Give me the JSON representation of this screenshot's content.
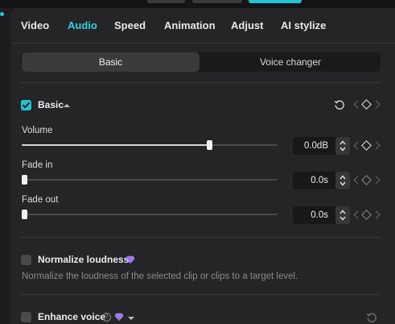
{
  "tabs": [
    {
      "label": "Video",
      "active": false
    },
    {
      "label": "Audio",
      "active": true
    },
    {
      "label": "Speed",
      "active": false
    },
    {
      "label": "Animation",
      "active": false
    },
    {
      "label": "Adjust",
      "active": false
    },
    {
      "label": "AI stylize",
      "active": false
    }
  ],
  "segmented": {
    "basic_label": "Basic",
    "voice_changer_label": "Voice changer",
    "selected": "Basic"
  },
  "basic_section": {
    "title": "Basic",
    "checked": true,
    "expanded": true,
    "controls": [
      {
        "label": "Volume",
        "value": "0.0dB",
        "slider_fraction": 0.74
      },
      {
        "label": "Fade in",
        "value": "0.0s",
        "slider_fraction": 0.0
      },
      {
        "label": "Fade out",
        "value": "0.0s",
        "slider_fraction": 0.0
      }
    ]
  },
  "normalize_section": {
    "title": "Normalize loudness",
    "checked": false,
    "premium": true,
    "description": "Normalize the loudness of the selected clip or clips to a target level."
  },
  "enhance_section": {
    "title": "Enhance voice",
    "checked": false,
    "premium": true
  },
  "colors": {
    "accent": "#2ad3e0",
    "checkbox_checked": "#22c4d4",
    "premium_gem": "#b48cff"
  },
  "icons": {
    "reset": "reset-icon",
    "keyframe": "keyframe-diamond-icon",
    "premium": "gem-icon",
    "info": "info-icon"
  }
}
